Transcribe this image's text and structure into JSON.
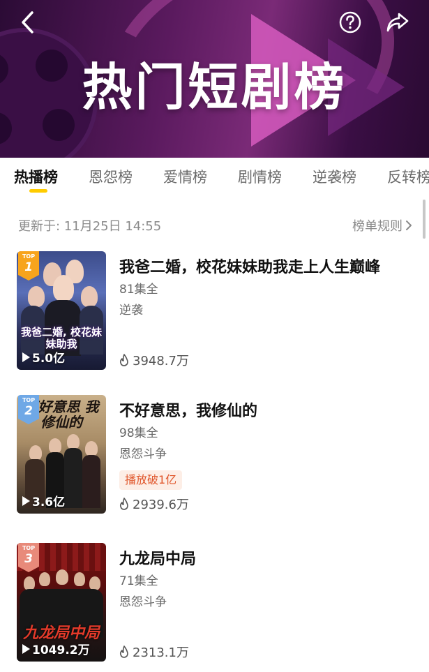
{
  "banner": {
    "title": "热门短剧榜"
  },
  "tabs": [
    {
      "label": "热播榜",
      "active": true
    },
    {
      "label": "恩怨榜",
      "active": false
    },
    {
      "label": "爱情榜",
      "active": false
    },
    {
      "label": "剧情榜",
      "active": false
    },
    {
      "label": "逆袭榜",
      "active": false
    },
    {
      "label": "反转榜",
      "active": false
    }
  ],
  "update": {
    "text": "更新于: 11月25日 14:55",
    "rules_label": "榜单规则"
  },
  "list": [
    {
      "rank_top": "TOP",
      "rank": "1",
      "poster_caption": "我爸二婚, 校花妹妹助我",
      "play_count": "5.0亿",
      "title": "我爸二婚，校花妹妹助我走上人生巅峰",
      "episodes": "81集全",
      "genre": "逆袭",
      "tag": "",
      "heat": "3948.7万"
    },
    {
      "rank_top": "TOP",
      "rank": "2",
      "poster_caption": "不好意思 我修仙的",
      "play_count": "3.6亿",
      "title": "不好意思，我修仙的",
      "episodes": "98集全",
      "genre": "恩怨斗争",
      "tag": "播放破1亿",
      "heat": "2939.6万"
    },
    {
      "rank_top": "TOP",
      "rank": "3",
      "poster_caption": "九龙局中局",
      "play_count": "1049.2万",
      "title": "九龙局中局",
      "episodes": "71集全",
      "genre": "恩怨斗争",
      "tag": "",
      "heat": "2313.1万"
    }
  ],
  "colors": {
    "tab_indicator": "#ffcc00",
    "rank1": "#f7a41d",
    "rank2": "#6fa8e6",
    "rank3": "#e88a7a",
    "tag_text": "#e0562b",
    "tag_bg": "#fdeee6"
  },
  "icons": {
    "back": "chevron-left-icon",
    "help": "question-circle-icon",
    "share": "share-arrow-icon",
    "rules": "chevron-right-icon",
    "play": "play-triangle-icon",
    "heat": "flame-icon"
  }
}
